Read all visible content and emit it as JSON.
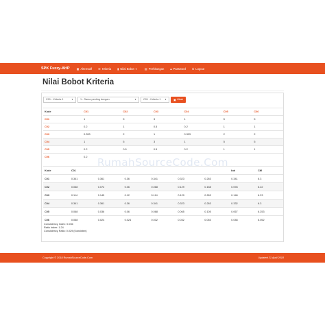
{
  "navbar": {
    "brand": "SPK Fuzzy-AHP",
    "items": [
      {
        "label": "Alternatif",
        "icon": "th-icon"
      },
      {
        "label": "Kriteria",
        "icon": "list-icon"
      },
      {
        "label": "Nilai Bobot",
        "icon": "signal-icon"
      },
      {
        "label": "Perhitungan",
        "icon": "calculator-icon"
      },
      {
        "label": "Password",
        "icon": "lock-icon"
      },
      {
        "label": "Logout",
        "icon": "power-icon"
      }
    ]
  },
  "page": {
    "title": "Nilai Bobot Kriteria"
  },
  "form": {
    "select1": "C01 - Kriteria 1",
    "select2": "1 - Sama penting dengan",
    "select3": "C01 - Kriteria 1",
    "button": "Ubah"
  },
  "matrix": {
    "headers": [
      "Kode",
      "C01",
      "C02",
      "C03",
      "C04",
      "C05",
      "C06"
    ],
    "rows": [
      {
        "code": "C01",
        "values": [
          "1",
          "5",
          "3",
          "1",
          "5",
          "5"
        ]
      },
      {
        "code": "C02",
        "values": [
          "0.2",
          "1",
          "0.5",
          "0.2",
          "1",
          "1"
        ]
      },
      {
        "code": "C03",
        "values": [
          "0.333",
          "2",
          "1",
          "0.333",
          "2",
          "2"
        ]
      },
      {
        "code": "C04",
        "values": [
          "1",
          "5",
          "3",
          "1",
          "5",
          "5"
        ]
      },
      {
        "code": "C05",
        "values": [
          "0.2",
          "0.5",
          "0.5",
          "0.2",
          "1",
          "1"
        ]
      },
      {
        "code": "C06",
        "values": [
          "0.2",
          "",
          "",
          "",
          "",
          ""
        ]
      }
    ]
  },
  "normalized": {
    "headers": [
      "Kode",
      "C01",
      "",
      "",
      "",
      "",
      "",
      "bot",
      "CM"
    ],
    "rows": [
      {
        "code": "C01",
        "values": [
          "0.341",
          "0.361",
          "0.36",
          "0.341",
          "0.323",
          "0.263",
          "0.341",
          "6.3"
        ]
      },
      {
        "code": "C02",
        "values": [
          "0.068",
          "0.072",
          "0.06",
          "0.068",
          "0.129",
          "0.158",
          "0.093",
          "6.22"
        ]
      },
      {
        "code": "C03",
        "values": [
          "0.114",
          "0.145",
          "0.12",
          "0.114",
          "0.129",
          "0.263",
          "0.148",
          "6.23"
        ]
      },
      {
        "code": "C04",
        "values": [
          "0.341",
          "0.361",
          "0.36",
          "0.341",
          "0.323",
          "0.263",
          "0.332",
          "6.3"
        ]
      },
      {
        "code": "C05",
        "values": [
          "0.068",
          "0.036",
          "0.06",
          "0.068",
          "0.065",
          "0.105",
          "0.067",
          "6.253"
        ]
      },
      {
        "code": "C06",
        "values": [
          "0.068",
          "0.024",
          "0.024",
          "0.032",
          "0.032",
          "0.053",
          "0.048",
          "6.052"
        ]
      }
    ]
  },
  "ratios": {
    "ci": "Consistency Index: 0.036",
    "ri": "Ratio Index: 1.24",
    "cr": "Consistency Ratio: 0.029 (Konsisten)"
  },
  "watermark": "RumahSourceCode.Com",
  "footer": {
    "left": "Copyright © 2018 RumahSourceCode.Com",
    "right": "Updated 21 April 2018"
  },
  "colors": {
    "accent": "#e8501f"
  }
}
